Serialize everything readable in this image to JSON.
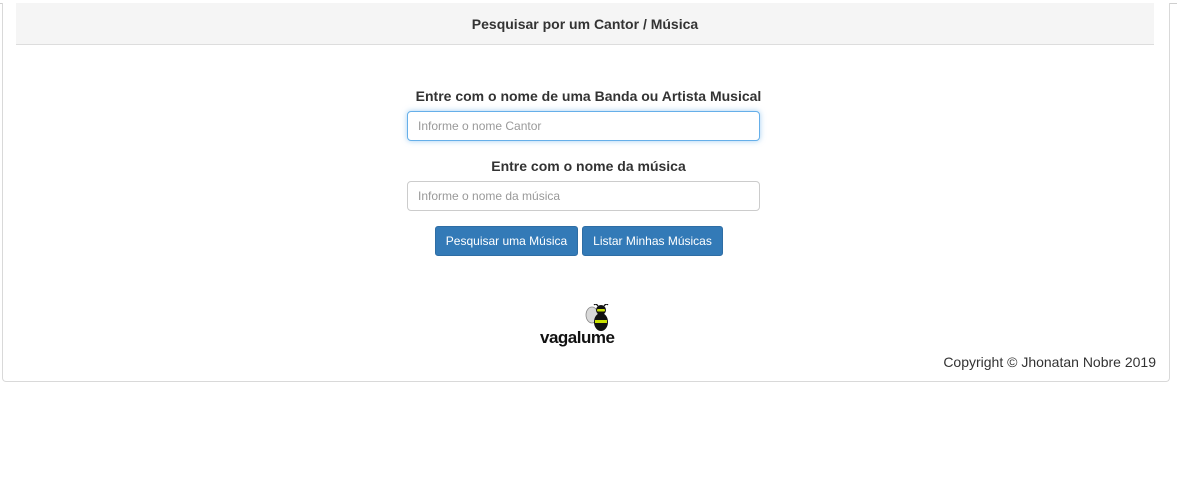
{
  "header": {
    "title": "Pesquisar por um Cantor / Música"
  },
  "form": {
    "artist_label": "Entre com o nome de uma Banda ou Artista Musical",
    "artist_placeholder": "Informe o nome Cantor",
    "artist_value": "",
    "song_label": "Entre com o nome da música",
    "song_placeholder": "Informe o nome da música",
    "song_value": ""
  },
  "buttons": {
    "search_label": "Pesquisar uma Música",
    "list_label": "Listar Minhas Músicas"
  },
  "logo": {
    "text": "vagalume",
    "icon": "firefly-icon"
  },
  "footer": {
    "copyright": "Copyright © Jhonatan Nobre 2019"
  },
  "colors": {
    "primary": "#337ab7",
    "header_bg": "#f5f5f5",
    "focus": "#66afe9",
    "logo_accent": "#c8e000"
  }
}
